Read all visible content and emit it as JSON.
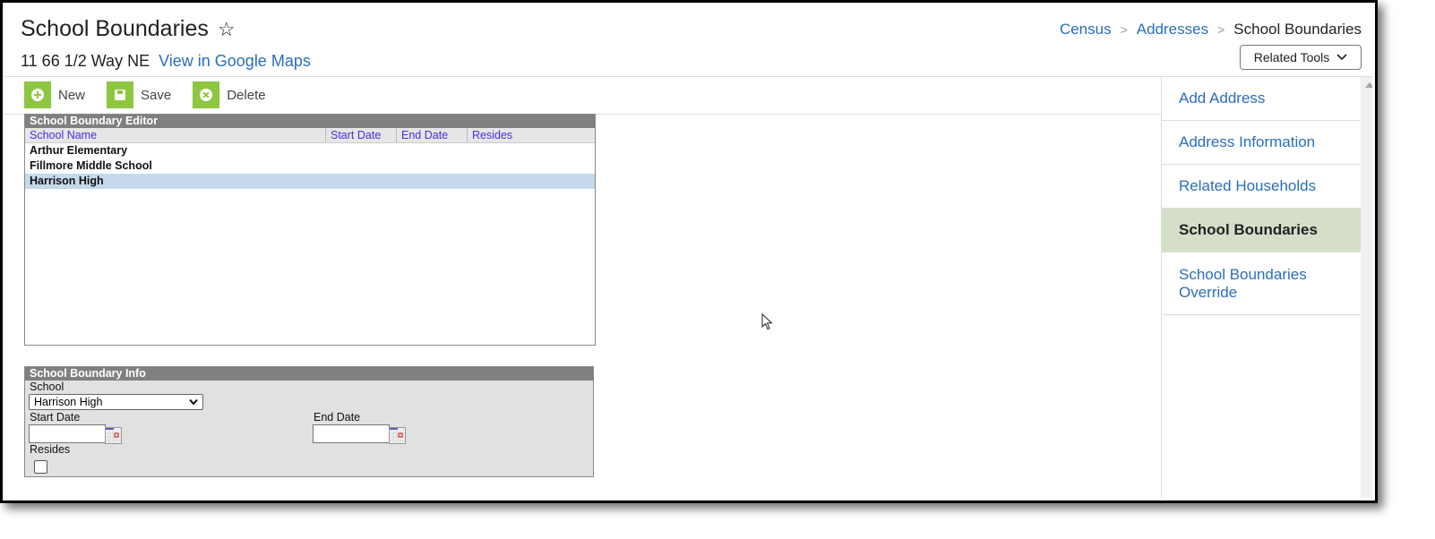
{
  "header": {
    "title": "School Boundaries",
    "address": "11 66 1/2 Way NE",
    "maps_link": "View in Google Maps",
    "breadcrumb": [
      "Census",
      "Addresses",
      "School Boundaries"
    ],
    "related_tools": "Related Tools"
  },
  "toolbar": {
    "new_label": "New",
    "save_label": "Save",
    "delete_label": "Delete"
  },
  "editor": {
    "title": "School Boundary Editor",
    "columns": [
      "School Name",
      "Start Date",
      "End Date",
      "Resides"
    ],
    "rows": [
      {
        "school": "Arthur Elementary",
        "start": "",
        "end": "",
        "resides": "",
        "selected": false
      },
      {
        "school": "Fillmore Middle School",
        "start": "",
        "end": "",
        "resides": "",
        "selected": false
      },
      {
        "school": "Harrison High",
        "start": "",
        "end": "",
        "resides": "",
        "selected": true
      }
    ]
  },
  "info": {
    "title": "School Boundary Info",
    "school_label": "School",
    "school_value": "Harrison High",
    "start_label": "Start Date",
    "start_value": "",
    "end_label": "End Date",
    "end_value": "",
    "resides_label": "Resides",
    "resides_checked": false
  },
  "sidebar": {
    "items": [
      {
        "label": "Add Address",
        "active": false
      },
      {
        "label": "Address Information",
        "active": false
      },
      {
        "label": "Related Households",
        "active": false
      },
      {
        "label": "School Boundaries",
        "active": true
      },
      {
        "label": "School Boundaries Override",
        "active": false
      }
    ]
  },
  "colors": {
    "accent_link": "#2a6ebb",
    "toolbar_icon": "#8dc63f",
    "panel_header": "#808080",
    "selected_row": "#c5d9ec",
    "active_sidebar": "#d5dec9",
    "column_header_text": "#4a2ce0"
  }
}
